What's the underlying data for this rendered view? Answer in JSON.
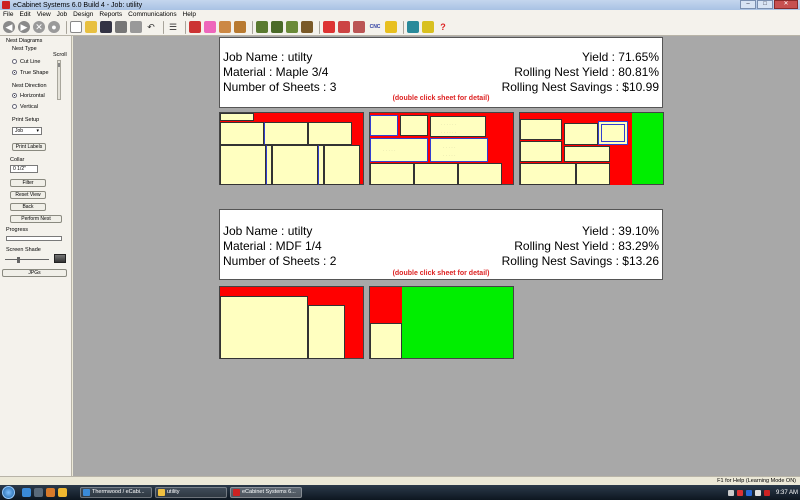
{
  "window": {
    "title": "eCabinet Systems 6.0 Build 4 - Job: utility"
  },
  "menu": [
    "File",
    "Edit",
    "View",
    "Job",
    "Design",
    "Reports",
    "Communications",
    "Help"
  ],
  "toolbar": {
    "cnc_label": "CNC",
    "help_label": "?"
  },
  "left_panel": {
    "section_title": "Nest Diagrams",
    "nest_type_label": "Nest Type",
    "scroll_label": "Scroll",
    "cut_line": "Cut Line",
    "true_shape": "True Shape",
    "nest_direction_label": "Nest Direction",
    "horizontal": "Horizontal",
    "vertical": "Vertical",
    "print_setup_label": "Print Setup",
    "print_select_value": "Job",
    "print_labels": "Print Labels",
    "collar_label": "Collar",
    "collar_value": "0 1/2\"",
    "filter": "Filter",
    "reset_view": "Reset View",
    "back": "Back",
    "perform_nest": "Perform Nest",
    "progress_label": "Progress",
    "screen_shade_label": "Screen Shade",
    "jpgs": "JPGs"
  },
  "materials": [
    {
      "job_name_label": "Job Name :  utilty",
      "material_label": "Material :  Maple 3/4",
      "sheets_label": "Number of Sheets :  3",
      "yield_label": "Yield :  71.65%",
      "rolling_yield_label": "Rolling Nest Yield :  80.81%",
      "rolling_savings_label": "Rolling Nest Savings :  $10.99",
      "hint": "(double click sheet for detail)"
    },
    {
      "job_name_label": "Job Name :  utilty",
      "material_label": "Material :  MDF 1/4",
      "sheets_label": "Number of Sheets :  2",
      "yield_label": "Yield :  39.10%",
      "rolling_yield_label": "Rolling Nest Yield :  83.29%",
      "rolling_savings_label": "Rolling Nest Savings :  $13.26",
      "hint": "(double click sheet for detail)"
    }
  ],
  "status": {
    "text": "F1 for Help (Learning Mode ON)"
  },
  "taskbar": {
    "tasks": [
      "Thermwood / eCabi...",
      "utility",
      "eCabinet Systems 6..."
    ],
    "clock": "9:37 AM"
  },
  "colors": {
    "waste": "#ff0000",
    "part": "#ffffc0",
    "free_sheet": "#00ee00",
    "grain_line": "#3340d0"
  }
}
